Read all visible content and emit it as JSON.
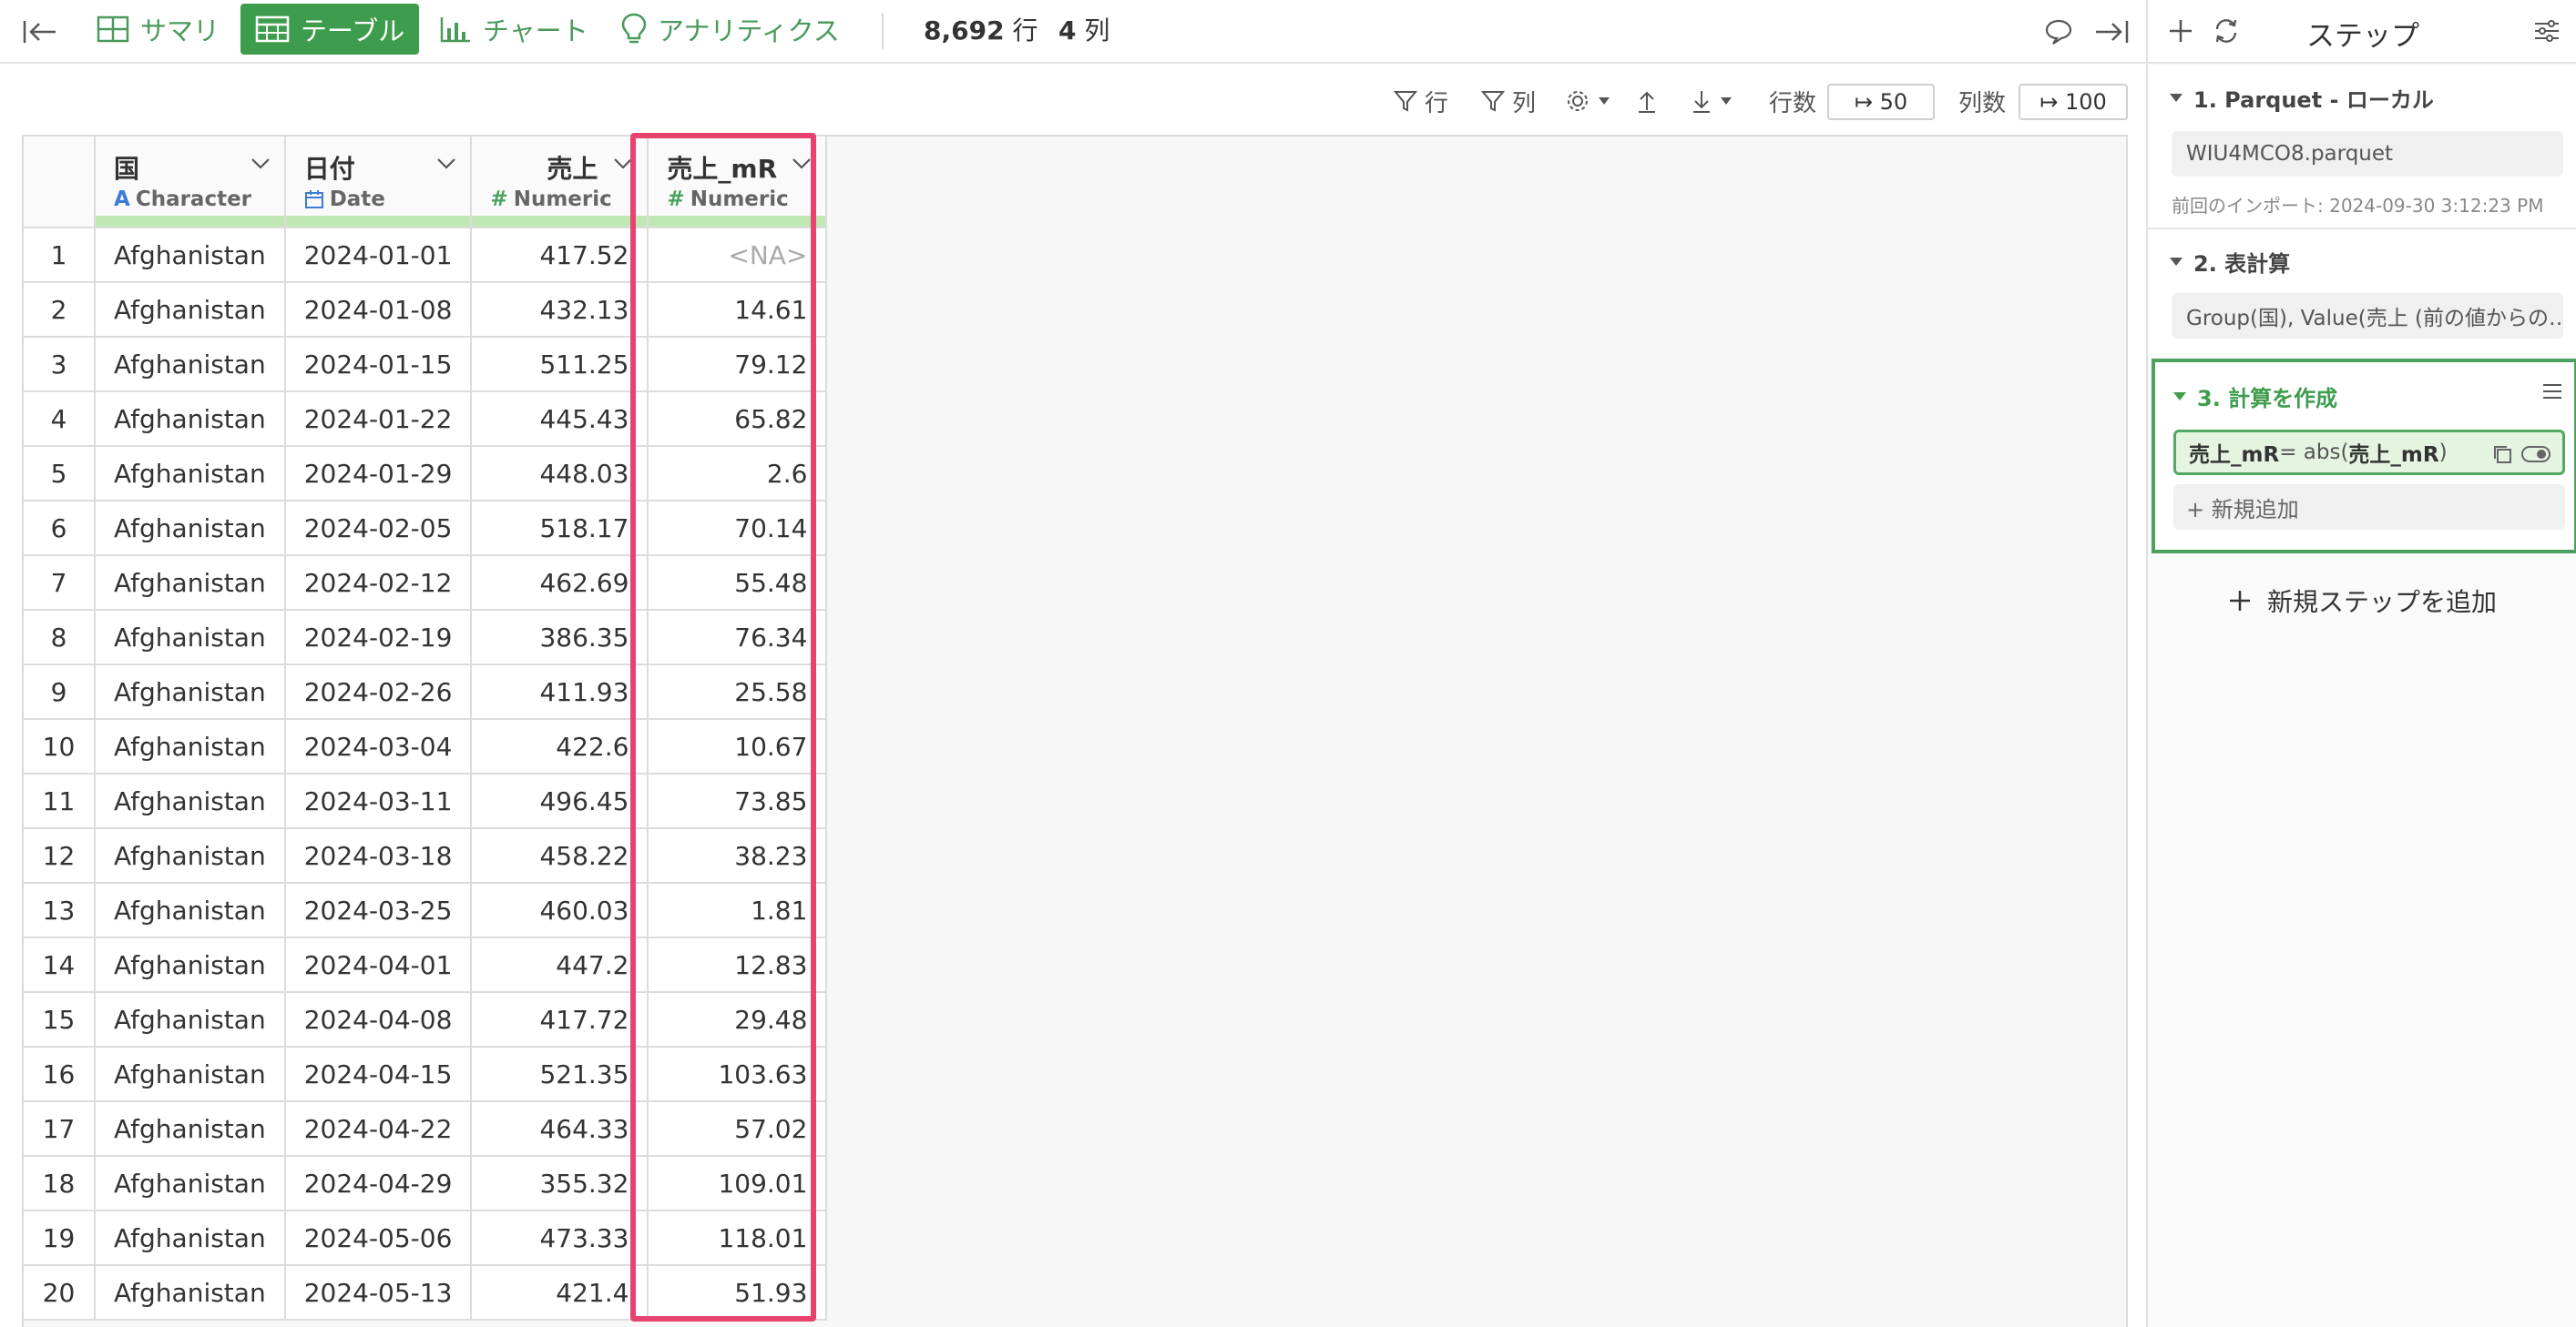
{
  "top": {
    "tabs": [
      {
        "label": "サマリ",
        "icon": "grid-icon",
        "active": false
      },
      {
        "label": "テーブル",
        "icon": "table-icon",
        "active": true
      },
      {
        "label": "チャート",
        "icon": "bar-chart-icon",
        "active": false
      },
      {
        "label": "アナリティクス",
        "icon": "lightbulb-icon",
        "active": false
      }
    ],
    "rows_count": "8,692",
    "rows_unit": "行",
    "cols_count": "4",
    "cols_unit": "列"
  },
  "toolbar": {
    "row_filter": "行",
    "col_filter": "列",
    "rows_label": "行数",
    "rows_value": "↦ 50",
    "cols_label": "列数",
    "cols_value": "↦ 100"
  },
  "table": {
    "columns": [
      {
        "name": "国",
        "type": "Character",
        "type_icon": "A",
        "type_color": "#3d7bd6"
      },
      {
        "name": "日付",
        "type": "Date",
        "type_icon": "calendar",
        "type_color": "#3d7bd6"
      },
      {
        "name": "売上",
        "type": "Numeric",
        "type_icon": "#",
        "type_color": "#4aa25e"
      },
      {
        "name": "売上_mR",
        "type": "Numeric",
        "type_icon": "#",
        "type_color": "#4aa25e"
      }
    ],
    "rows": [
      [
        "1",
        "Afghanistan",
        "2024-01-01",
        "417.52",
        "<NA>"
      ],
      [
        "2",
        "Afghanistan",
        "2024-01-08",
        "432.13",
        "14.61"
      ],
      [
        "3",
        "Afghanistan",
        "2024-01-15",
        "511.25",
        "79.12"
      ],
      [
        "4",
        "Afghanistan",
        "2024-01-22",
        "445.43",
        "65.82"
      ],
      [
        "5",
        "Afghanistan",
        "2024-01-29",
        "448.03",
        "2.6"
      ],
      [
        "6",
        "Afghanistan",
        "2024-02-05",
        "518.17",
        "70.14"
      ],
      [
        "7",
        "Afghanistan",
        "2024-02-12",
        "462.69",
        "55.48"
      ],
      [
        "8",
        "Afghanistan",
        "2024-02-19",
        "386.35",
        "76.34"
      ],
      [
        "9",
        "Afghanistan",
        "2024-02-26",
        "411.93",
        "25.58"
      ],
      [
        "10",
        "Afghanistan",
        "2024-03-04",
        "422.6",
        "10.67"
      ],
      [
        "11",
        "Afghanistan",
        "2024-03-11",
        "496.45",
        "73.85"
      ],
      [
        "12",
        "Afghanistan",
        "2024-03-18",
        "458.22",
        "38.23"
      ],
      [
        "13",
        "Afghanistan",
        "2024-03-25",
        "460.03",
        "1.81"
      ],
      [
        "14",
        "Afghanistan",
        "2024-04-01",
        "447.2",
        "12.83"
      ],
      [
        "15",
        "Afghanistan",
        "2024-04-08",
        "417.72",
        "29.48"
      ],
      [
        "16",
        "Afghanistan",
        "2024-04-15",
        "521.35",
        "103.63"
      ],
      [
        "17",
        "Afghanistan",
        "2024-04-22",
        "464.33",
        "57.02"
      ],
      [
        "18",
        "Afghanistan",
        "2024-04-29",
        "355.32",
        "109.01"
      ],
      [
        "19",
        "Afghanistan",
        "2024-05-06",
        "473.33",
        "118.01"
      ],
      [
        "20",
        "Afghanistan",
        "2024-05-13",
        "421.4",
        "51.93"
      ]
    ]
  },
  "sidebar": {
    "title": "ステップ",
    "steps": [
      {
        "title": "1. Parquet - ローカル",
        "chip": "WIU4MCO8.parquet",
        "sub": "前回のインポート: 2024-09-30 3:12:23 PM"
      },
      {
        "title": "2. 表計算",
        "chip": "Group(国), Value(売上 (前の値からの…"
      },
      {
        "title": "3. 計算を作成",
        "formula_name": "売上_mR",
        "formula_eq": " = abs(",
        "formula_arg": "売上_mR",
        "formula_close": ")",
        "add_new": "+ 新規追加"
      }
    ],
    "add_step": "新規ステップを追加"
  },
  "colors": {
    "accent": "#3e9d4c",
    "highlight": "#e8436f"
  }
}
